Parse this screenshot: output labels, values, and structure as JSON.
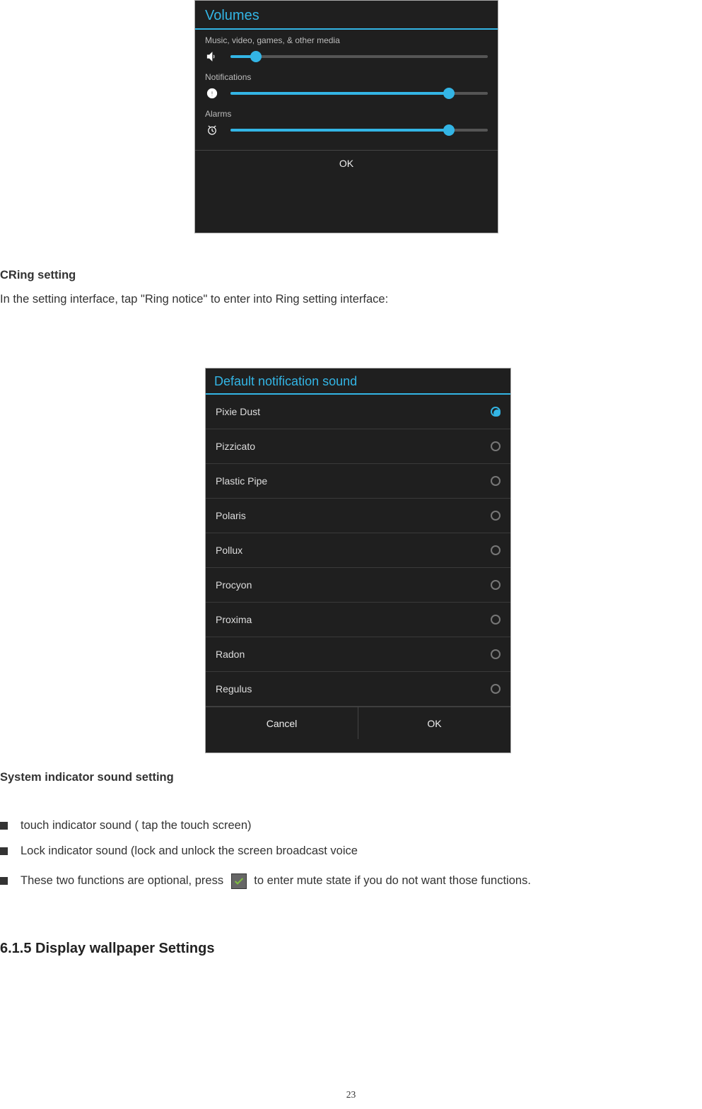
{
  "shot1": {
    "title": "Volumes",
    "v1": {
      "label": "Music, video, games, & other media",
      "pct": 10
    },
    "v2": {
      "label": "Notifications",
      "pct": 85
    },
    "v3": {
      "label": "Alarms",
      "pct": 85
    },
    "ok": "OK"
  },
  "t1": {
    "h": "CRing setting",
    "p": "In the setting interface, tap \"Ring notice\" to enter into Ring setting interface:"
  },
  "shot2": {
    "title": "Default notification sound",
    "items": [
      {
        "label": "Pixie Dust",
        "sel": true
      },
      {
        "label": "Pizzicato",
        "sel": false
      },
      {
        "label": "Plastic Pipe",
        "sel": false
      },
      {
        "label": "Polaris",
        "sel": false
      },
      {
        "label": "Pollux",
        "sel": false
      },
      {
        "label": "Procyon",
        "sel": false
      },
      {
        "label": "Proxima",
        "sel": false
      },
      {
        "label": "Radon",
        "sel": false
      },
      {
        "label": "Regulus",
        "sel": false
      }
    ],
    "cancel": "Cancel",
    "ok": "OK"
  },
  "t2": {
    "h": "System indicator sound setting"
  },
  "bul": {
    "b1": "touch indicator sound ( tap the touch screen)",
    "b2": "Lock indicator sound (lock and unlock the screen broadcast voice",
    "b3a": "These two functions are optional, press ",
    "b3b": " to enter mute state if you do not want those functions."
  },
  "section": "6.1.5 Display wallpaper Settings",
  "pagenum": "23"
}
